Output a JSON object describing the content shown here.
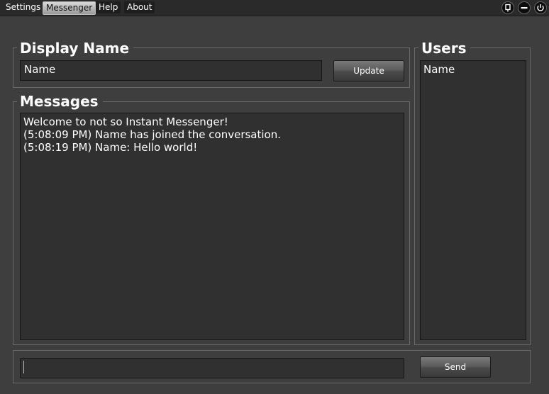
{
  "menu": {
    "items": [
      {
        "label": "Settings"
      },
      {
        "label": "Messenger"
      },
      {
        "label": "Help"
      },
      {
        "label": "About"
      }
    ]
  },
  "display_name": {
    "title": "Display Name",
    "value": "Name",
    "update_label": "Update"
  },
  "messages": {
    "title": "Messages",
    "lines": [
      "Welcome to not so Instant Messenger!",
      "(5:08:09 PM) Name has joined the conversation.",
      "(5:08:19 PM) Name: Hello world!"
    ]
  },
  "users": {
    "title": "Users",
    "list": [
      "Name"
    ]
  },
  "composer": {
    "value": "",
    "send_label": "Send"
  },
  "window_controls": [
    "pin-icon",
    "minimize-icon",
    "power-icon"
  ]
}
